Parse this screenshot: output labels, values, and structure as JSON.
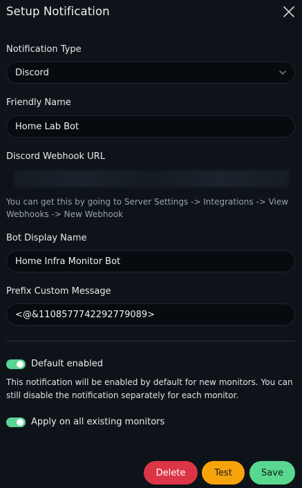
{
  "dialog": {
    "title": "Setup Notification"
  },
  "notification_type": {
    "label": "Notification Type",
    "value": "Discord"
  },
  "friendly_name": {
    "label": "Friendly Name",
    "value": "Home Lab Bot"
  },
  "webhook": {
    "label": "Discord Webhook URL",
    "help": "You can get this by going to Server Settings -> Integrations -> View Webhooks -> New Webhook"
  },
  "bot_display_name": {
    "label": "Bot Display Name",
    "value": "Home Infra Monitor Bot"
  },
  "prefix_message": {
    "label": "Prefix Custom Message",
    "value": "<@&1108577742292779089>"
  },
  "default_enabled": {
    "label": "Default enabled",
    "checked": true,
    "description": "This notification will be enabled by default for new monitors. You can still disable the notification separately for each monitor."
  },
  "apply_existing": {
    "label": "Apply on all existing monitors",
    "checked": true
  },
  "buttons": {
    "delete": "Delete",
    "test": "Test",
    "save": "Save"
  },
  "colors": {
    "background": "#0e1319",
    "input_bg": "#070a0f",
    "toggle_on": "#5bd493",
    "delete": "#dc3545",
    "test": "#f7a30c",
    "save": "#5bd88f"
  }
}
